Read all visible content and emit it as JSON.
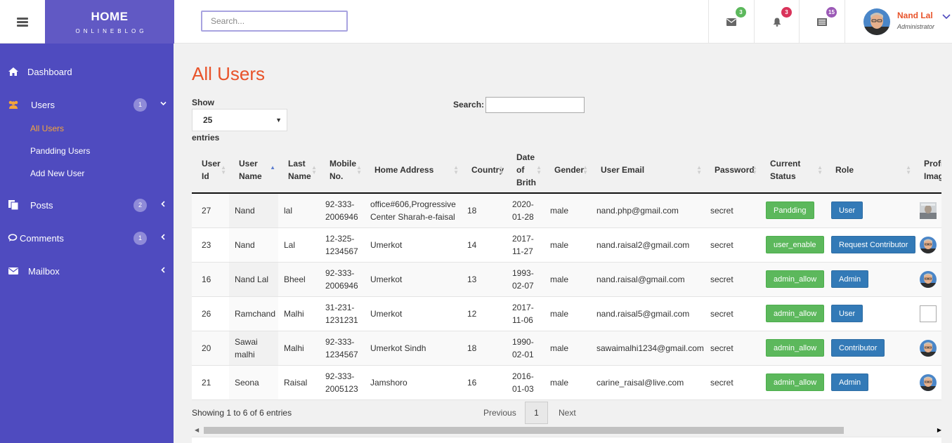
{
  "brand": {
    "title": "HOME",
    "subtitle": "ONLINEBLOG"
  },
  "top_search": {
    "placeholder": "Search..."
  },
  "top_icons": [
    {
      "icon": "envelope-icon",
      "badge": "3",
      "badge_color": "#5cb85c"
    },
    {
      "icon": "bell-icon",
      "badge": "3",
      "badge_color": "#d9335a"
    },
    {
      "icon": "list-icon",
      "badge": "15",
      "badge_color": "#9b59b6"
    }
  ],
  "user": {
    "name": "Nand Lal",
    "role": "Administrator"
  },
  "sidebar": {
    "items": [
      {
        "label": "Dashboard",
        "icon": "home-icon"
      },
      {
        "label": "Users",
        "icon": "users-icon",
        "badge": "1",
        "chevron": "down",
        "sub": [
          {
            "label": "All Users",
            "active": true
          },
          {
            "label": "Pandding Users"
          },
          {
            "label": "Add New User"
          }
        ]
      },
      {
        "label": "Posts",
        "icon": "copy-icon",
        "badge": "2",
        "chevron": "left"
      },
      {
        "label": "Comments",
        "icon": "comments-icon",
        "badge": "1",
        "chevron": "left"
      },
      {
        "label": "Mailbox",
        "icon": "envelope-icon",
        "chevron": "left"
      }
    ]
  },
  "main": {
    "title": "All Users",
    "show_label": "Show",
    "page_size": "25",
    "entries_label": "entries",
    "search_label": "Search:",
    "search_value": ""
  },
  "table": {
    "columns": [
      "User Id",
      "User Name",
      "Last Name",
      "Mobile No.",
      "Home Address",
      "Country",
      "Date of Brith",
      "Gender",
      "User Email",
      "Password",
      "Current Status",
      "Role",
      "Profile Image"
    ],
    "sorted_column": "User Name",
    "rows": [
      {
        "id": "27",
        "name": "Nand",
        "last": "lal",
        "mobile": "92-333-2006946",
        "address": "office#606,Progressive Center Sharah-e-faisal",
        "country": "18",
        "dob": "2020-01-28",
        "gender": "male",
        "email": "nand.php@gmail.com",
        "password": "secret",
        "status": "Pandding",
        "role": "User",
        "image": "photo-square"
      },
      {
        "id": "23",
        "name": "Nand",
        "last": "Lal",
        "mobile": "12-325-1234567",
        "address": "Umerkot",
        "country": "14",
        "dob": "2017-11-27",
        "gender": "male",
        "email": "nand.raisal2@gmail.com",
        "password": "secret",
        "status": "user_enable",
        "role": "Request Contributor",
        "image": "avatar"
      },
      {
        "id": "16",
        "name": "Nand Lal",
        "last": "Bheel",
        "mobile": "92-333-2006946",
        "address": "Umerkot",
        "country": "13",
        "dob": "1993-02-07",
        "gender": "male",
        "email": "nand.raisal@gmail.com",
        "password": "secret",
        "status": "admin_allow",
        "role": "Admin",
        "image": "avatar"
      },
      {
        "id": "26",
        "name": "Ramchand",
        "last": "Malhi",
        "mobile": "31-231-1231231",
        "address": "Umerkot",
        "country": "12",
        "dob": "2017-11-06",
        "gender": "male",
        "email": "nand.raisal5@gmail.com",
        "password": "secret",
        "status": "admin_allow",
        "role": "User",
        "image": "broken"
      },
      {
        "id": "20",
        "name": "Sawai malhi",
        "last": "Malhi",
        "mobile": "92-333-1234567",
        "address": "Umerkot Sindh",
        "country": "18",
        "dob": "1990-02-01",
        "gender": "male",
        "email": "sawaimalhi1234@gmail.com",
        "password": "secret",
        "status": "admin_allow",
        "role": "Contributor",
        "image": "avatar"
      },
      {
        "id": "21",
        "name": "Seona",
        "last": "Raisal",
        "mobile": "92-333-2005123",
        "address": "Jamshoro",
        "country": "16",
        "dob": "2016-01-03",
        "gender": "male",
        "email": "carine_raisal@live.com",
        "password": "secret",
        "status": "admin_allow",
        "role": "Admin",
        "image": "avatar"
      }
    ]
  },
  "footer": {
    "info": "Showing 1 to 6 of 6 entries",
    "previous": "Previous",
    "page": "1",
    "next": "Next"
  }
}
